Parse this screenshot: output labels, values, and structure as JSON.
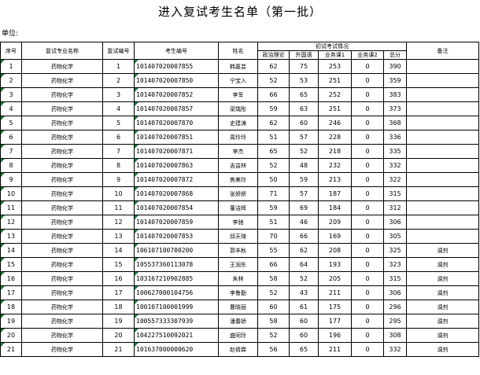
{
  "title": "进入复试考生名单（第一批）",
  "unit_label": "单位:",
  "headers": {
    "seq": "序号",
    "major": "复试专业名称",
    "retest_no": "复试编号",
    "ticket": "考生编号",
    "name": "姓名",
    "initial_group": "初试考试情况",
    "politics": "政治理论",
    "foreign": "外国语",
    "course1": "业务课1",
    "course2": "业务课2",
    "total": "总分",
    "remarks": "备注"
  },
  "rows": [
    {
      "seq": "1",
      "major": "药物化学",
      "retest_no": "1",
      "ticket": "101407020007855",
      "name": "韩嘉芸",
      "politics": "62",
      "foreign": "75",
      "course1": "253",
      "course2": "0",
      "total": "390",
      "remark": ""
    },
    {
      "seq": "2",
      "major": "药物化学",
      "retest_no": "2",
      "ticket": "101407020007850",
      "name": "宁宝入",
      "politics": "52",
      "foreign": "53",
      "course1": "251",
      "course2": "0",
      "total": "359",
      "remark": ""
    },
    {
      "seq": "3",
      "major": "药物化学",
      "retest_no": "3",
      "ticket": "101407020007852",
      "name": "李军",
      "politics": "66",
      "foreign": "65",
      "course1": "252",
      "course2": "0",
      "total": "383",
      "remark": ""
    },
    {
      "seq": "4",
      "major": "药物化学",
      "retest_no": "4",
      "ticket": "101407020007857",
      "name": "梁瑞彤",
      "politics": "59",
      "foreign": "63",
      "course1": "251",
      "course2": "0",
      "total": "373",
      "remark": ""
    },
    {
      "seq": "5",
      "major": "药物化学",
      "retest_no": "5",
      "ticket": "101407020007870",
      "name": "史建涛",
      "politics": "62",
      "foreign": "60",
      "course1": "246",
      "course2": "0",
      "total": "368",
      "remark": ""
    },
    {
      "seq": "6",
      "major": "药物化学",
      "retest_no": "6",
      "ticket": "101407020007851",
      "name": "周玲玲",
      "politics": "51",
      "foreign": "57",
      "course1": "228",
      "course2": "0",
      "total": "336",
      "remark": ""
    },
    {
      "seq": "7",
      "major": "药物化学",
      "retest_no": "7",
      "ticket": "101407020007871",
      "name": "李杰",
      "politics": "65",
      "foreign": "52",
      "course1": "218",
      "course2": "0",
      "total": "335",
      "remark": ""
    },
    {
      "seq": "8",
      "major": "药物化学",
      "retest_no": "8",
      "ticket": "101407020007863",
      "name": "吉益林",
      "politics": "52",
      "foreign": "48",
      "course1": "232",
      "course2": "0",
      "total": "332",
      "remark": ""
    },
    {
      "seq": "9",
      "major": "药物化学",
      "retest_no": "9",
      "ticket": "101407020007872",
      "name": "焦美玲",
      "politics": "50",
      "foreign": "59",
      "course1": "213",
      "course2": "0",
      "total": "322",
      "remark": ""
    },
    {
      "seq": "10",
      "major": "药物化学",
      "retest_no": "10",
      "ticket": "101407020007868",
      "name": "张娇娇",
      "politics": "71",
      "foreign": "57",
      "course1": "187",
      "course2": "0",
      "total": "315",
      "remark": ""
    },
    {
      "seq": "11",
      "major": "药物化学",
      "retest_no": "11",
      "ticket": "101407020007854",
      "name": "董洁辉",
      "politics": "59",
      "foreign": "69",
      "course1": "184",
      "course2": "0",
      "total": "312",
      "remark": ""
    },
    {
      "seq": "12",
      "major": "药物化学",
      "retest_no": "12",
      "ticket": "101407020007859",
      "name": "李驰",
      "politics": "51",
      "foreign": "46",
      "course1": "209",
      "course2": "0",
      "total": "306",
      "remark": ""
    },
    {
      "seq": "13",
      "major": "药物化学",
      "retest_no": "13",
      "ticket": "101407020007853",
      "name": "邱天琦",
      "politics": "70",
      "foreign": "66",
      "course1": "169",
      "course2": "0",
      "total": "305",
      "remark": ""
    },
    {
      "seq": "14",
      "major": "药物化学",
      "retest_no": "14",
      "ticket": "106107100700200",
      "name": "郭丰秋",
      "politics": "55",
      "foreign": "62",
      "course1": "208",
      "course2": "0",
      "total": "325",
      "remark": "调剂"
    },
    {
      "seq": "15",
      "major": "药物化学",
      "retest_no": "15",
      "ticket": "105537360113078",
      "name": "王润东",
      "politics": "66",
      "foreign": "64",
      "course1": "193",
      "course2": "0",
      "total": "323",
      "remark": "调剂"
    },
    {
      "seq": "16",
      "major": "药物化学",
      "retest_no": "16",
      "ticket": "103167210902885",
      "name": "朱林",
      "politics": "58",
      "foreign": "52",
      "course1": "205",
      "course2": "0",
      "total": "315",
      "remark": "调剂"
    },
    {
      "seq": "17",
      "major": "药物化学",
      "retest_no": "17",
      "ticket": "100627000104756",
      "name": "李鲁勤",
      "politics": "52",
      "foreign": "43",
      "course1": "211",
      "course2": "0",
      "total": "306",
      "remark": "调剂"
    },
    {
      "seq": "18",
      "major": "药物化学",
      "retest_no": "18",
      "ticket": "100107100001999",
      "name": "曹晓丽",
      "politics": "60",
      "foreign": "61",
      "course1": "175",
      "course2": "0",
      "total": "296",
      "remark": "调剂"
    },
    {
      "seq": "19",
      "major": "药物化学",
      "retest_no": "19",
      "ticket": "100557333307939",
      "name": "潘春娇",
      "politics": "58",
      "foreign": "60",
      "course1": "177",
      "course2": "0",
      "total": "295",
      "remark": "调剂"
    },
    {
      "seq": "20",
      "major": "药物化学",
      "retest_no": "20",
      "ticket": "104227510092021",
      "name": "盛同玲",
      "politics": "52",
      "foreign": "60",
      "course1": "196",
      "course2": "0",
      "total": "308",
      "remark": "调剂"
    },
    {
      "seq": "21",
      "major": "药物化学",
      "retest_no": "21",
      "ticket": "101637000000620",
      "name": "赵倩霖",
      "politics": "56",
      "foreign": "65",
      "course1": "211",
      "course2": "0",
      "total": "332",
      "remark": "调剂"
    }
  ],
  "colors": {
    "grid": "#000000",
    "marker": "#1a7a3a"
  }
}
